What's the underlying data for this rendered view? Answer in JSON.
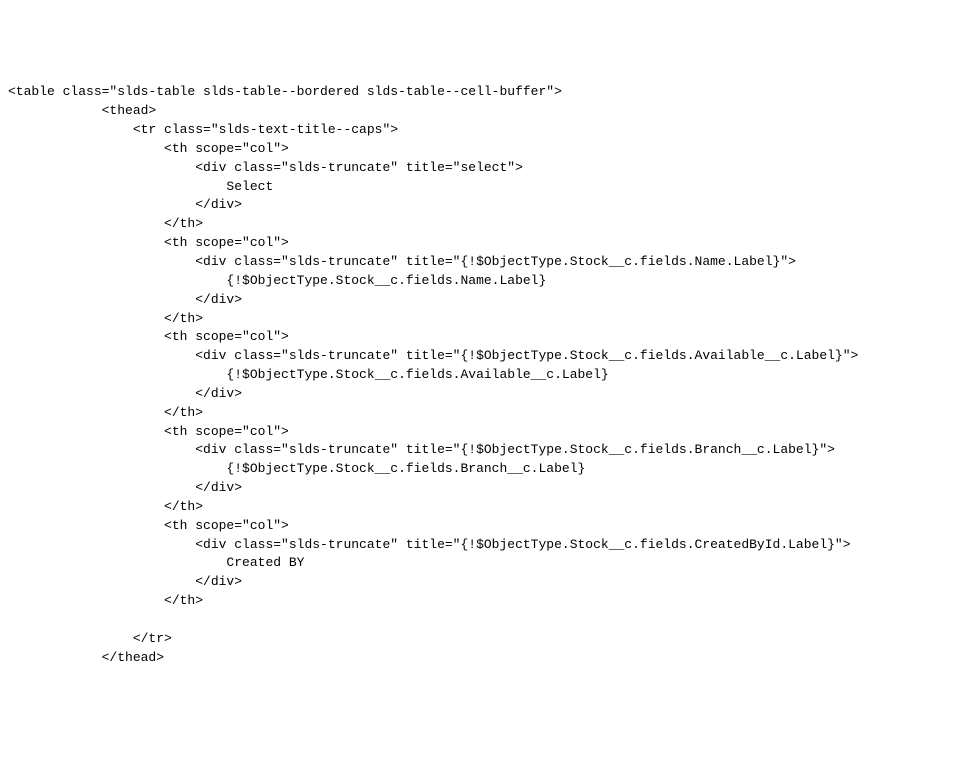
{
  "code": {
    "lines": [
      "<table class=\"slds-table slds-table--bordered slds-table--cell-buffer\">",
      "            <thead>",
      "                <tr class=\"slds-text-title--caps\">",
      "                    <th scope=\"col\">",
      "                        <div class=\"slds-truncate\" title=\"select\">",
      "                            Select",
      "                        </div>",
      "                    </th>",
      "                    <th scope=\"col\">",
      "                        <div class=\"slds-truncate\" title=\"{!$ObjectType.Stock__c.fields.Name.Label}\">",
      "                            {!$ObjectType.Stock__c.fields.Name.Label}",
      "                        </div>",
      "                    </th>",
      "                    <th scope=\"col\">",
      "                        <div class=\"slds-truncate\" title=\"{!$ObjectType.Stock__c.fields.Available__c.Label}\">",
      "                            {!$ObjectType.Stock__c.fields.Available__c.Label}",
      "                        </div>",
      "                    </th>",
      "                    <th scope=\"col\">",
      "                        <div class=\"slds-truncate\" title=\"{!$ObjectType.Stock__c.fields.Branch__c.Label}\">",
      "                            {!$ObjectType.Stock__c.fields.Branch__c.Label}",
      "                        </div>",
      "                    </th>",
      "                    <th scope=\"col\">",
      "                        <div class=\"slds-truncate\" title=\"{!$ObjectType.Stock__c.fields.CreatedById.Label}\">",
      "                            Created BY",
      "                        </div>",
      "                    </th>",
      "                    ",
      "                </tr>",
      "            </thead>"
    ]
  }
}
